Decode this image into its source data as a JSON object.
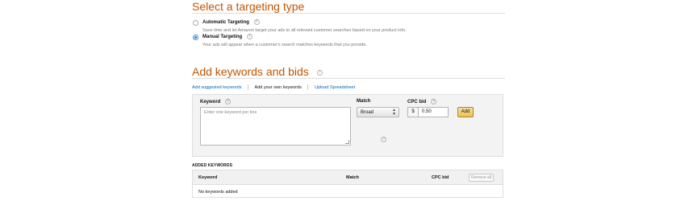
{
  "targeting": {
    "title": "Select a targeting type",
    "options": [
      {
        "label": "Automatic Targeting",
        "description": "Save time and let Amazon target your ads to all relevant customer searches based on your product info.",
        "selected": false
      },
      {
        "label": "Manual Targeting",
        "description": "Your ads will appear when a customer's search matches keywords that you provide.",
        "selected": true
      }
    ]
  },
  "keywords": {
    "title": "Add keywords and bids",
    "tabs": [
      "Add suggested keywords",
      "Add your own keywords",
      "Upload Spreadsheet"
    ],
    "active_tab": 1,
    "form": {
      "keyword_label": "Keyword",
      "keyword_placeholder": "Enter one keyword per line",
      "match_label": "Match",
      "match_value": "Broad",
      "bid_label": "CPC bid",
      "currency_symbol": "$",
      "bid_value": "0.50",
      "add_label": "Add"
    }
  },
  "added": {
    "heading": "ADDED KEYWORDS",
    "columns": [
      "Keyword",
      "Match",
      "CPC bid"
    ],
    "remove_all_label": "Remove all",
    "empty_text": "No keywords added"
  },
  "colors": {
    "section_title": "#c45500",
    "link": "#0066c0",
    "add_button": "#f0c14b",
    "radio_selected": "#2f7fd0"
  },
  "icons": {
    "info": "info-icon",
    "select_caret": "chevron-updown-icon",
    "radio": "radio-icon"
  }
}
